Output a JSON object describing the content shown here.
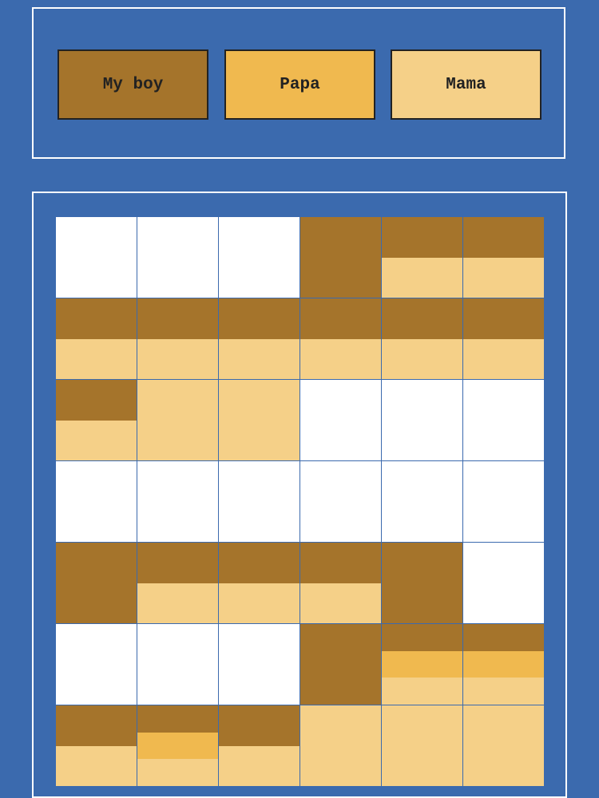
{
  "colors": {
    "background": "#3b6aae",
    "panel_border": "#ffffff",
    "empty": "#ffffff",
    "my_boy": "#a5742b",
    "papa": "#f0b94f",
    "mama": "#f5d088"
  },
  "legend": [
    {
      "key": "my_boy",
      "label": "My boy",
      "color": "#a5742b"
    },
    {
      "key": "papa",
      "label": "Papa",
      "color": "#f0b94f"
    },
    {
      "key": "mama",
      "label": "Mama",
      "color": "#f5d088"
    }
  ],
  "grid": {
    "columns": 6,
    "rows": [
      [
        [],
        [],
        [],
        [
          [
            "my_boy",
            1
          ]
        ],
        [
          [
            "my_boy",
            0.5
          ],
          [
            "mama",
            0.5
          ]
        ],
        [
          [
            "my_boy",
            0.5
          ],
          [
            "mama",
            0.5
          ]
        ]
      ],
      [
        [
          [
            "my_boy",
            0.5
          ],
          [
            "mama",
            0.5
          ]
        ],
        [
          [
            "my_boy",
            0.5
          ],
          [
            "mama",
            0.5
          ]
        ],
        [
          [
            "my_boy",
            0.5
          ],
          [
            "mama",
            0.5
          ]
        ],
        [
          [
            "my_boy",
            0.5
          ],
          [
            "mama",
            0.5
          ]
        ],
        [
          [
            "my_boy",
            0.5
          ],
          [
            "mama",
            0.5
          ]
        ],
        [
          [
            "my_boy",
            0.5
          ],
          [
            "mama",
            0.5
          ]
        ]
      ],
      [
        [
          [
            "my_boy",
            0.5
          ],
          [
            "mama",
            0.5
          ]
        ],
        [
          [
            "mama",
            1
          ]
        ],
        [
          [
            "mama",
            1
          ]
        ],
        [],
        [],
        []
      ],
      [
        [],
        [],
        [],
        [],
        [],
        []
      ],
      [
        [
          [
            "my_boy",
            1
          ]
        ],
        [
          [
            "my_boy",
            0.5
          ],
          [
            "mama",
            0.5
          ]
        ],
        [
          [
            "my_boy",
            0.5
          ],
          [
            "mama",
            0.5
          ]
        ],
        [
          [
            "my_boy",
            0.5
          ],
          [
            "mama",
            0.5
          ]
        ],
        [
          [
            "my_boy",
            1
          ]
        ],
        []
      ],
      [
        [],
        [],
        [],
        [
          [
            "my_boy",
            1
          ]
        ],
        [
          [
            "my_boy",
            0.333
          ],
          [
            "papa",
            0.333
          ],
          [
            "mama",
            0.334
          ]
        ],
        [
          [
            "my_boy",
            0.333
          ],
          [
            "papa",
            0.333
          ],
          [
            "mama",
            0.334
          ]
        ]
      ],
      [
        [
          [
            "my_boy",
            0.5
          ],
          [
            "mama",
            0.5
          ]
        ],
        [
          [
            "my_boy",
            0.333
          ],
          [
            "papa",
            0.333
          ],
          [
            "mama",
            0.334
          ]
        ],
        [
          [
            "my_boy",
            0.5
          ],
          [
            "mama",
            0.5
          ]
        ],
        [
          [
            "mama",
            1
          ]
        ],
        [
          [
            "mama",
            1
          ]
        ],
        [
          [
            "mama",
            1
          ]
        ]
      ]
    ]
  }
}
